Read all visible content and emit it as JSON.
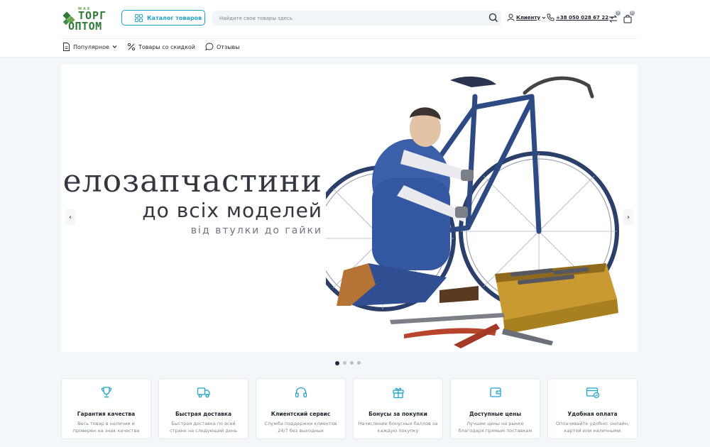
{
  "brand": {
    "logo_small": "МАЕ",
    "logo_line1": "ТОРГ",
    "logo_line2": "ОПТОМ"
  },
  "header": {
    "catalog_label": "Каталог товаров",
    "search_placeholder": "Найдите свои товары здесь",
    "client_label": "Клиенту",
    "phone": "+38 050 028 67 22",
    "compare_count": "0",
    "cart_count": "0"
  },
  "nav": {
    "items": [
      {
        "label": "Популярное",
        "icon": "document-icon"
      },
      {
        "label": "Товары со скидкой",
        "icon": "percent-icon"
      },
      {
        "label": "Отзывы",
        "icon": "chat-icon"
      }
    ]
  },
  "hero": {
    "title": "Велозапчастини",
    "subtitle": "до всіх моделей",
    "tagline": "від втулки до гайки",
    "prev": "‹",
    "next": "›",
    "slides": 4,
    "active_slide": 1
  },
  "features": [
    {
      "title": "Гарантия качества",
      "desc": "Весь товар в наличии и проверен на знак качества",
      "icon": "trophy-icon"
    },
    {
      "title": "Быстрая доставка",
      "desc": "Быстрая доставка по всей стране на следующий день",
      "icon": "truck-icon"
    },
    {
      "title": "Клиентский сервис",
      "desc": "Служба поддержки клиентов 24/7 без выходных",
      "icon": "headphones-icon"
    },
    {
      "title": "Бонусы за покупки",
      "desc": "Начисление бонусных баллов за каждую покупку",
      "icon": "gift-icon"
    },
    {
      "title": "Доступные цены",
      "desc": "Лучшие цены на рынке благодаря прямым поставкам",
      "icon": "wallet-icon"
    },
    {
      "title": "Удобная оплата",
      "desc": "Оплачивайте удобно: онлайн, картой или наличными",
      "icon": "card-icon"
    }
  ],
  "colors": {
    "accent": "#1fa2c9",
    "brand_green": "#2f7a39",
    "text_dark": "#1e2430",
    "muted": "#7d8690"
  }
}
